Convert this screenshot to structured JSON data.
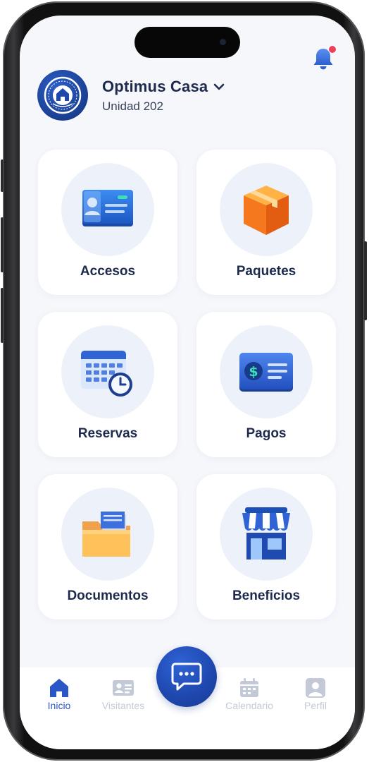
{
  "header": {
    "community_name": "Optimus Casa",
    "unit": "Unidad 202",
    "notifications_unread": true
  },
  "tiles": [
    {
      "label": "Accesos",
      "icon": "id-card-icon"
    },
    {
      "label": "Paquetes",
      "icon": "package-icon"
    },
    {
      "label": "Reservas",
      "icon": "calendar-clock-icon"
    },
    {
      "label": "Pagos",
      "icon": "payment-card-icon"
    },
    {
      "label": "Documentos",
      "icon": "folder-icon"
    },
    {
      "label": "Beneficios",
      "icon": "store-icon"
    }
  ],
  "nav": {
    "items": [
      {
        "label": "Inicio",
        "icon": "home-icon",
        "active": true
      },
      {
        "label": "Visitantes",
        "icon": "visitors-icon",
        "active": false
      },
      {
        "label": "Calendario",
        "icon": "calendar-icon",
        "active": false
      },
      {
        "label": "Perfil",
        "icon": "profile-icon",
        "active": false
      }
    ],
    "center_button_icon": "chat-icon"
  },
  "colors": {
    "primary": "#1e47ad",
    "accent_active": "#2b56c6",
    "text_dark": "#1d2a4d",
    "inactive": "#c3c9d6",
    "screen_bg": "#f5f7fb",
    "badge_red": "#ef3e58"
  }
}
